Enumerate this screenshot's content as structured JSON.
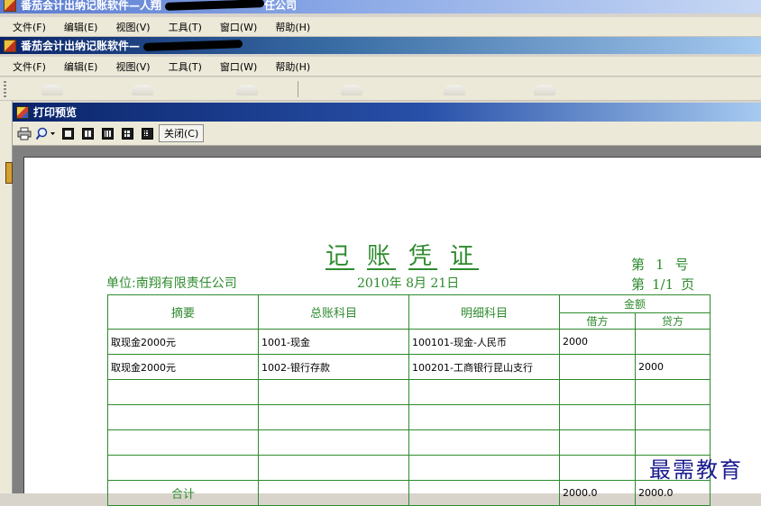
{
  "app": {
    "title": "番茄会计出纳记账软件—",
    "title_suffix_top": "人翔",
    "title_suffix_top2": "任公司"
  },
  "menu": [
    "文件(F)",
    "编辑(E)",
    "视图(V)",
    "工具(T)",
    "窗口(W)",
    "帮助(H)"
  ],
  "preview": {
    "title": "打印预览",
    "close_label": "关闭(C)"
  },
  "voucher": {
    "title_chars": [
      "记",
      "账",
      "凭",
      "证"
    ],
    "no_label": "第",
    "no_value": "1",
    "no_suffix": "号",
    "page_label": "第",
    "page_value": "1/1",
    "page_suffix": "页",
    "unit": "单位:南翔有限责任公司",
    "date": "2010年 8月 21日",
    "headers": {
      "summary": "摘要",
      "general_account": "总账科目",
      "detail_account": "明细科目",
      "amount": "金额",
      "debit": "借方",
      "credit": "贷方"
    },
    "rows": [
      {
        "summary": "取现金2000元",
        "general": "1001-现金",
        "detail": "100101-现金-人民币",
        "debit": "2000",
        "credit": ""
      },
      {
        "summary": "取现金2000元",
        "general": "1002-银行存款",
        "detail": "100201-工商银行昆山支行",
        "debit": "",
        "credit": "2000"
      },
      {
        "summary": "",
        "general": "",
        "detail": "",
        "debit": "",
        "credit": ""
      },
      {
        "summary": "",
        "general": "",
        "detail": "",
        "debit": "",
        "credit": ""
      },
      {
        "summary": "",
        "general": "",
        "detail": "",
        "debit": "",
        "credit": ""
      },
      {
        "summary": "",
        "general": "",
        "detail": "",
        "debit": "",
        "credit": ""
      }
    ],
    "total_label": "合计",
    "total_debit": "2000.0",
    "total_credit": "2000.0"
  },
  "watermark": "最需教育",
  "colors": {
    "voucher_green": "#2e8b2e",
    "titlebar_blue": "#0a246a",
    "watermark_blue": "#1a1a90"
  }
}
